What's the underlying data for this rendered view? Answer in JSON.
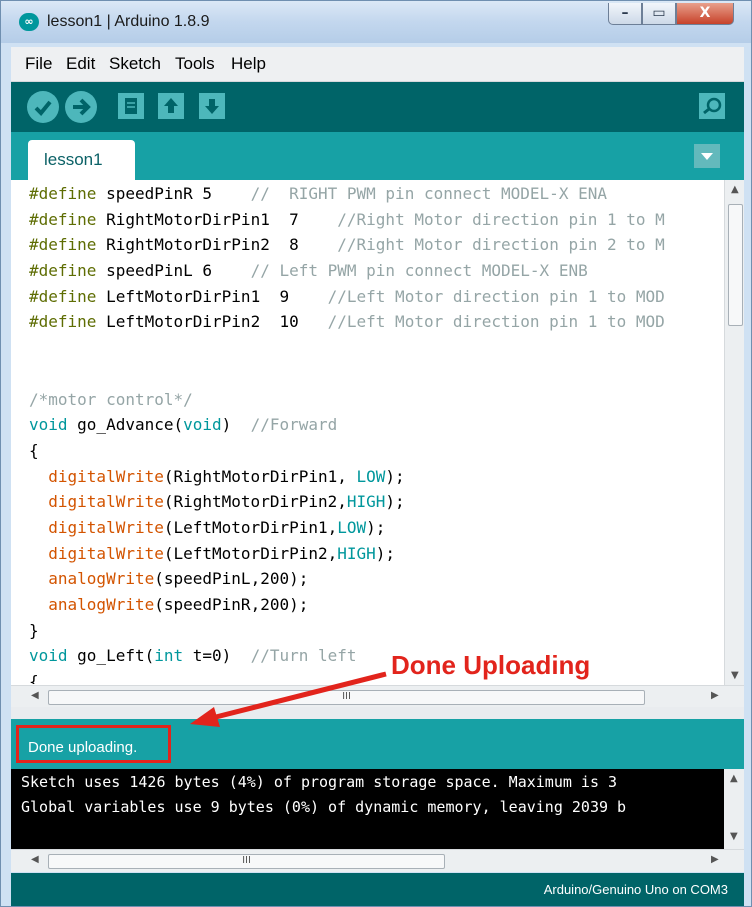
{
  "window": {
    "title": "lesson1 | Arduino 1.8.9",
    "icon_text": "∞",
    "controls": {
      "minimize": "–",
      "maximize": "▭",
      "close": "X"
    }
  },
  "menubar": {
    "items": [
      {
        "label": "File"
      },
      {
        "label": "Edit"
      },
      {
        "label": "Sketch"
      },
      {
        "label": "Tools"
      },
      {
        "label": "Help"
      }
    ]
  },
  "toolbar": {
    "buttons": [
      {
        "name": "verify",
        "icon": "check-icon"
      },
      {
        "name": "upload",
        "icon": "arrow-right-icon"
      },
      {
        "name": "new",
        "icon": "document-icon"
      },
      {
        "name": "open",
        "icon": "arrow-up-icon"
      },
      {
        "name": "save",
        "icon": "arrow-down-icon"
      },
      {
        "name": "serial-monitor",
        "icon": "magnifier-icon"
      }
    ]
  },
  "tabs": [
    {
      "label": "lesson1"
    }
  ],
  "editor": {
    "lines": [
      "#define speedPinR 5    //  RIGHT PWM pin connect MODEL-X ENA",
      "#define RightMotorDirPin1  7    //Right Motor direction pin 1 to M",
      "#define RightMotorDirPin2  8    //Right Motor direction pin 2 to M",
      "#define speedPinL 6    // Left PWM pin connect MODEL-X ENB",
      "#define LeftMotorDirPin1  9    //Left Motor direction pin 1 to MOD",
      "#define LeftMotorDirPin2  10   //Left Motor direction pin 1 to MOD",
      "",
      "",
      "/*motor control*/",
      "void go_Advance(void)  //Forward",
      "{",
      "  digitalWrite(RightMotorDirPin1, LOW);",
      "  digitalWrite(RightMotorDirPin2,HIGH);",
      "  digitalWrite(LeftMotorDirPin1,LOW);",
      "  digitalWrite(LeftMotorDirPin2,HIGH);",
      "  analogWrite(speedPinL,200);",
      "  analogWrite(speedPinR,200);",
      "}",
      "void go_Left(int t=0)  //Turn left",
      "{"
    ]
  },
  "annotation": {
    "text": "Done Uploading"
  },
  "status": {
    "message": "Done uploading."
  },
  "console": {
    "lines": [
      "Sketch uses 1426 bytes (4%) of program storage space. Maximum is 3",
      "Global variables use 9 bytes (0%) of dynamic memory, leaving 2039 b"
    ]
  },
  "footer": {
    "board": "Arduino/Genuino Uno on COM3"
  },
  "colors": {
    "toolbar": "#006468",
    "tabbar": "#17a1a5",
    "accent_red": "#e2241c",
    "directive": "#5e6d03",
    "function": "#d35400",
    "type": "#00979c",
    "comment": "#95a5a6"
  }
}
